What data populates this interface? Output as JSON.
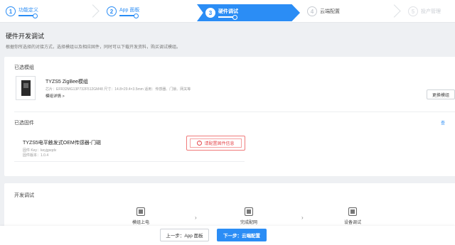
{
  "stepper": {
    "steps": [
      {
        "num": "1",
        "label": "功能定义"
      },
      {
        "num": "2",
        "label": "App 面板"
      },
      {
        "num": "3",
        "label": "硬件调试"
      },
      {
        "num": "4",
        "label": "云端配置"
      },
      {
        "num": "5",
        "label": "投产管理"
      }
    ]
  },
  "page": {
    "title": "硬件开发调试",
    "description": "根据你所选择的对接方式，选择模组以及相应固件，同时可以下载开发资料，购买调试模组。"
  },
  "module_section": {
    "title": "已选模组",
    "name": "TYZS5 ZigBee模组",
    "meta": "芯片：EFR32MG13P732F512GM48  尺寸：14.8×29.4×3.5mm  适用：传感器、门锁、网关等",
    "details_link": "模组详情 >",
    "change_button": "更换模组"
  },
  "firmware_section": {
    "title": "已选固件",
    "side_link": "查",
    "name": "TYZS5电平触发式OEM传感器-门磁",
    "key": "固件 Key：keyjgsqdv",
    "version": "固件版本：1.0.4",
    "config_button": "请配置固件信息"
  },
  "dev_section": {
    "title": "开发调试",
    "steps": [
      {
        "label": "模组上电"
      },
      {
        "label": "完成配网"
      },
      {
        "label": "设备调试"
      }
    ]
  },
  "footer": {
    "prev_label": "上一步：App 面板",
    "next_label": "下一步：云端配置"
  },
  "colors": {
    "accent": "#2b8df5",
    "warning": "#e5484d"
  }
}
